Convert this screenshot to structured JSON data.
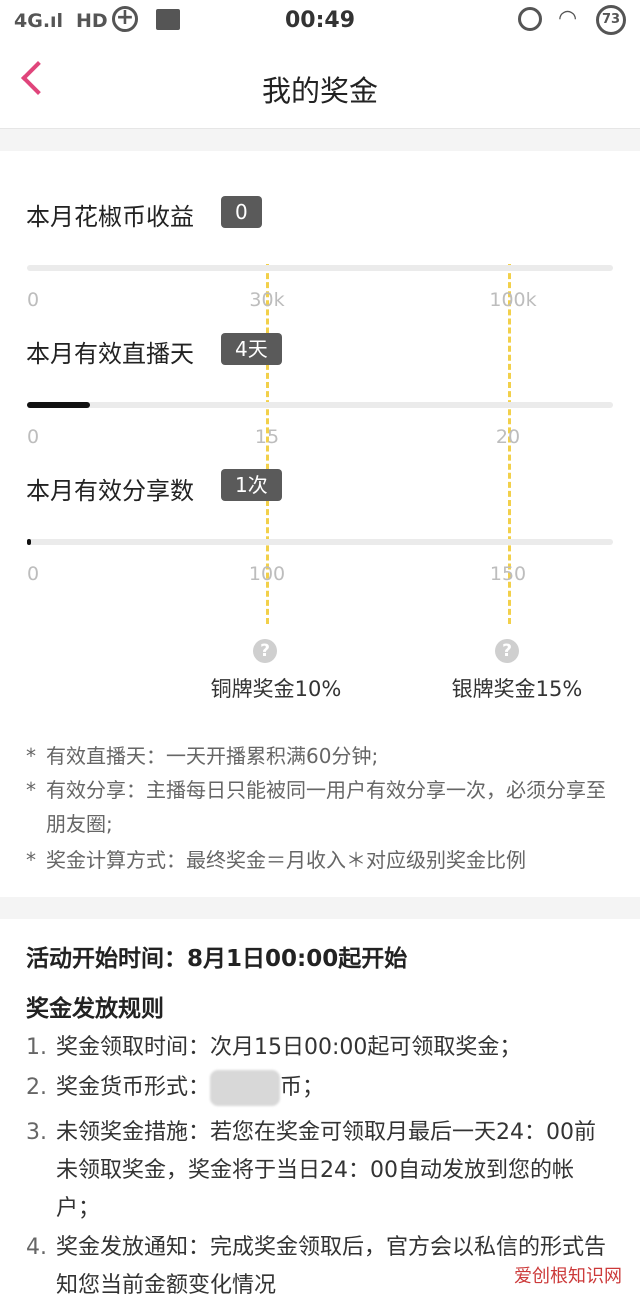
{
  "status_bar": {
    "network": "4G.ıl",
    "hd": "HD",
    "plus": "+",
    "time": "00:49",
    "wifi": "◠",
    "battery": "73"
  },
  "nav": {
    "title": "我的奖金"
  },
  "metrics": [
    {
      "label": "本月花椒币收益",
      "badge": "0",
      "progress": 0,
      "ticks": [
        "0",
        "30k",
        "100k"
      ]
    },
    {
      "label": "本月有效直播天",
      "badge": "4天",
      "progress": 0.107,
      "ticks": [
        "0",
        "15",
        "20"
      ]
    },
    {
      "label": "本月有效分享数",
      "badge": "1次",
      "progress": 0.006,
      "ticks": [
        "0",
        "100",
        "150"
      ]
    }
  ],
  "tiers": [
    {
      "help": "?",
      "label": "铜牌奖金10%"
    },
    {
      "help": "?",
      "label": "银牌奖金15%"
    }
  ],
  "notes": [
    {
      "star": "*",
      "text": "有效直播天：一天开播累积满60分钟;"
    },
    {
      "star": "*",
      "text": "有效分享：主播每日只能被同一用户有效分享一次，必须分享至朋友圈;"
    },
    {
      "star": "*",
      "text": "奖金计算方式：最终奖金＝月收入＊对应级别奖金比例"
    }
  ],
  "activity": {
    "start_time": "活动开始时间：8月1日00:00起开始",
    "rules_title": "奖金发放规则",
    "rules": [
      {
        "num": "1.",
        "text": "奖金领取时间：次月15日00:00起可领取奖金；"
      },
      {
        "num": "2.",
        "text_before": "奖金货币形式：",
        "text_after": "币；"
      },
      {
        "num": "3.",
        "text": "未领奖金措施：若您在奖金可领取月最后一天24：00前未领取奖金，奖金将于当日24：00自动发放到您的帐户；"
      },
      {
        "num": "4.",
        "text": "奖金发放通知：完成奖金领取后，官方会以私信的形式告知您当前金额变化情况"
      }
    ]
  },
  "watermark": "爱创根知识网",
  "colors": {
    "accent": "#e0457b",
    "threshold_line": "#f2d04a",
    "badge_bg": "#5a5a5a"
  }
}
